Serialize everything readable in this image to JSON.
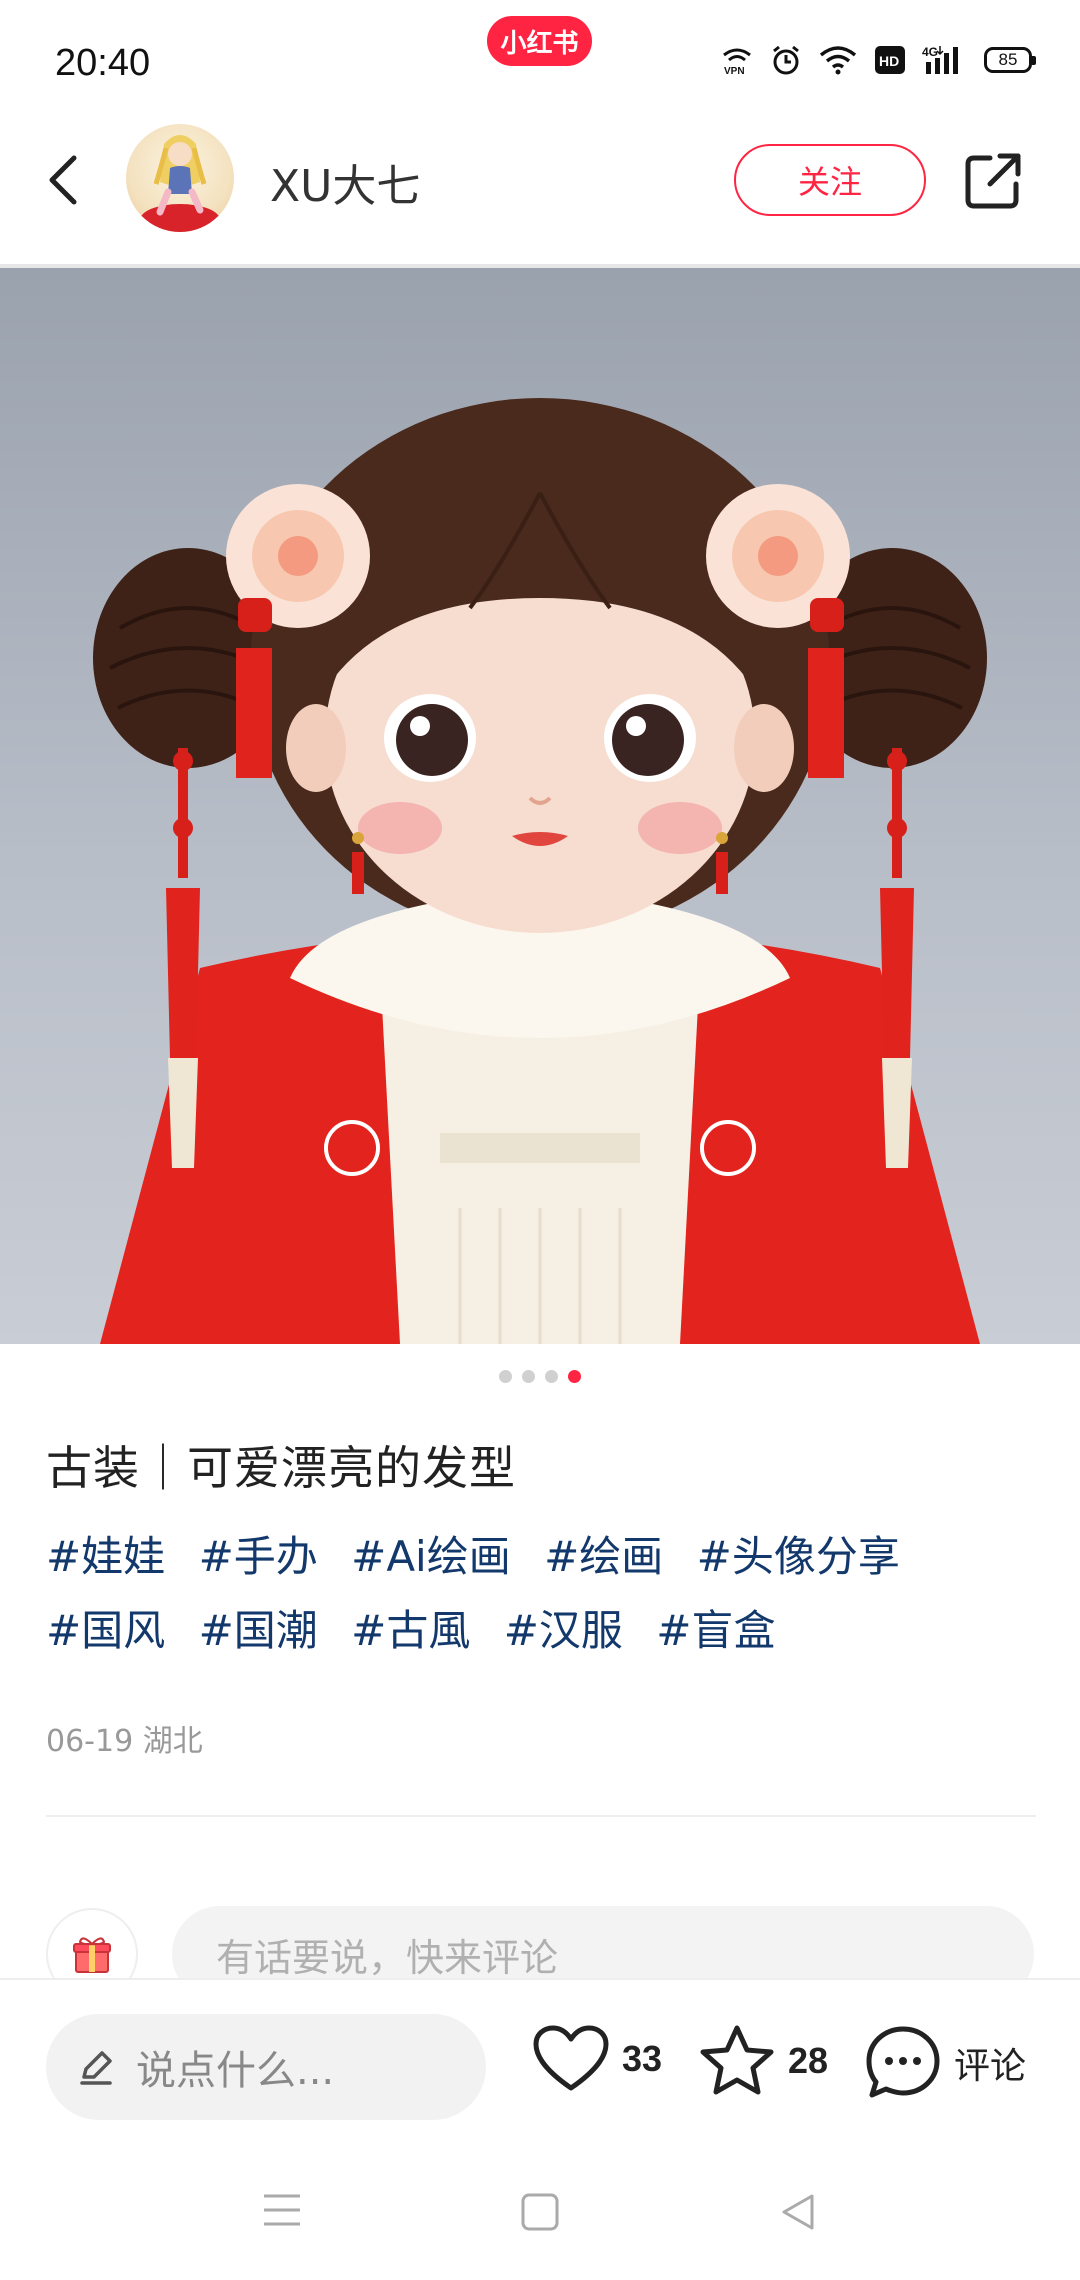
{
  "status_bar": {
    "time": "20:40",
    "app_badge": "小红书",
    "icons": [
      "vpn-icon",
      "alarm-icon",
      "wifi-icon",
      "hd-icon",
      "4g-signal-icon",
      "battery-icon"
    ],
    "battery_level": "85"
  },
  "header": {
    "author_name": "XU大七",
    "follow_label": "关注"
  },
  "carousel": {
    "page_count": 4,
    "active_index": 3
  },
  "post": {
    "title": "古装｜可爱漂亮的发型",
    "tags": [
      "#娃娃",
      "#手办",
      "#Ai绘画",
      "#绘画",
      "#头像分享",
      "#国风",
      "#国潮",
      "#古風",
      "#汉服",
      "#盲盒"
    ],
    "date_location": "06-19 湖北"
  },
  "comment_box": {
    "placeholder": "有话要说，快来评论"
  },
  "bottom_bar": {
    "input_placeholder": "说点什么...",
    "likes": "33",
    "collects": "28",
    "comment_label": "评论"
  },
  "colors": {
    "accent": "#ff2442",
    "tag": "#13386c"
  }
}
